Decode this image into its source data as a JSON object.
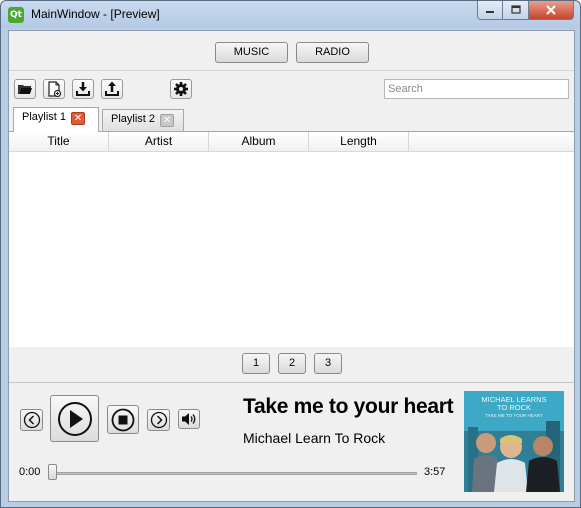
{
  "window": {
    "title": "MainWindow - [Preview]",
    "app_icon": "Qt"
  },
  "mode_bar": {
    "music_label": "MUSIC",
    "radio_label": "RADIO"
  },
  "toolbar": {
    "icons": [
      "folder-open-icon",
      "new-file-icon",
      "import-icon",
      "export-icon",
      "gear-icon"
    ],
    "search_placeholder": "Search"
  },
  "tabs": [
    {
      "label": "Playlist 1",
      "active": true
    },
    {
      "label": "Playlist 2",
      "active": false
    }
  ],
  "table": {
    "columns": [
      "Title",
      "Artist",
      "Album",
      "Length"
    ],
    "rows": []
  },
  "pager": {
    "pages": [
      "1",
      "2",
      "3"
    ]
  },
  "player": {
    "song_title": "Take me to your heart",
    "artist": "Michael Learn To Rock",
    "current_time": "0:00",
    "total_time": "3:57",
    "progress": 0,
    "album_art_text_1": "MICHAEL LEARNS",
    "album_art_text_2": "TO ROCK",
    "album_art_text_3": "TAKE ME TO YOUR HEART"
  },
  "colors": {
    "close_button": "#c6442c",
    "tab_close_active": "#e05a3a",
    "titlebar": "#b9cfe8",
    "album_bg": "#3aa6c4"
  }
}
